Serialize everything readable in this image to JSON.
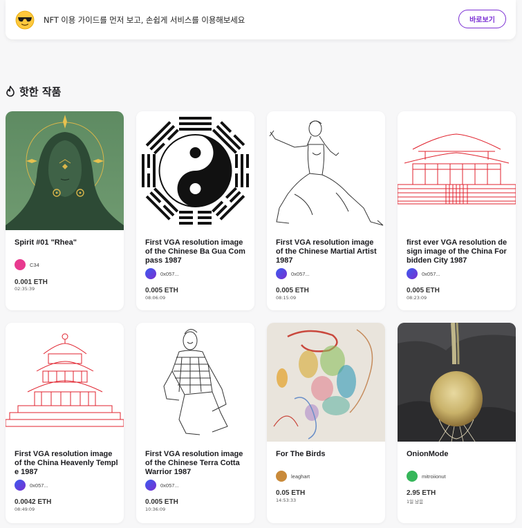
{
  "banner": {
    "message": "NFT 이용 가이드를 먼저 보고, 손쉽게 서비스를 이용해보세요",
    "button_label": "바로보기",
    "icon": "sunglasses-emoji-icon"
  },
  "section": {
    "title": "핫한 작품",
    "icon": "flame-icon"
  },
  "colors": {
    "accent": "#7b2fd4",
    "background": "#f7f7f8",
    "card": "#ffffff"
  },
  "cards": [
    {
      "title": "Spirit #01 \"Rhea\"",
      "owner": "C34",
      "price": "0.001 ETH",
      "time": "02:35:39",
      "avatar_color": "#e83a8f",
      "image": "hooded-spirit-artwork"
    },
    {
      "title": "First VGA resolution image of the Chinese Ba Gua Compass 1987",
      "owner": "0x057...",
      "price": "0.005 ETH",
      "time": "08:06:09",
      "avatar_color": "#5a3fd8",
      "image": "ba-gua-yin-yang-artwork"
    },
    {
      "title": "First VGA resolution image of the Chinese Martial Artist 1987",
      "owner": "0x057...",
      "price": "0.005 ETH",
      "time": "08:15:09",
      "avatar_color": "#5a3fd8",
      "image": "martial-artist-sketch"
    },
    {
      "title": "first ever VGA resolution design image of the China Forbidden City 1987",
      "owner": "0x057...",
      "price": "0.005 ETH",
      "time": "08:23:09",
      "avatar_color": "#5a3fd8",
      "image": "forbidden-city-line-art"
    },
    {
      "title": "First VGA resolution image of the China Heavenly Temple 1987",
      "owner": "0x057...",
      "price": "0.0042 ETH",
      "time": "08:49:09",
      "avatar_color": "#5a3fd8",
      "image": "heavenly-temple-line-art"
    },
    {
      "title": "First VGA resolution image of the Chinese Terra Cotta Warrior 1987",
      "owner": "0x057...",
      "price": "0.005 ETH",
      "time": "10:36:09",
      "avatar_color": "#5a3fd8",
      "image": "terra-cotta-warrior-sketch"
    },
    {
      "title": "For The Birds",
      "owner": "leaghart",
      "price": "0.05 ETH",
      "time": "14:53:33",
      "avatar_color": "#c98a3a",
      "image": "watercolor-birds-painting"
    },
    {
      "title": "OnionMode",
      "owner": "mitroiionut",
      "price": "2.95 ETH",
      "time": "1일 남음",
      "avatar_color": "#36b65a",
      "image": "onion-photo"
    }
  ]
}
